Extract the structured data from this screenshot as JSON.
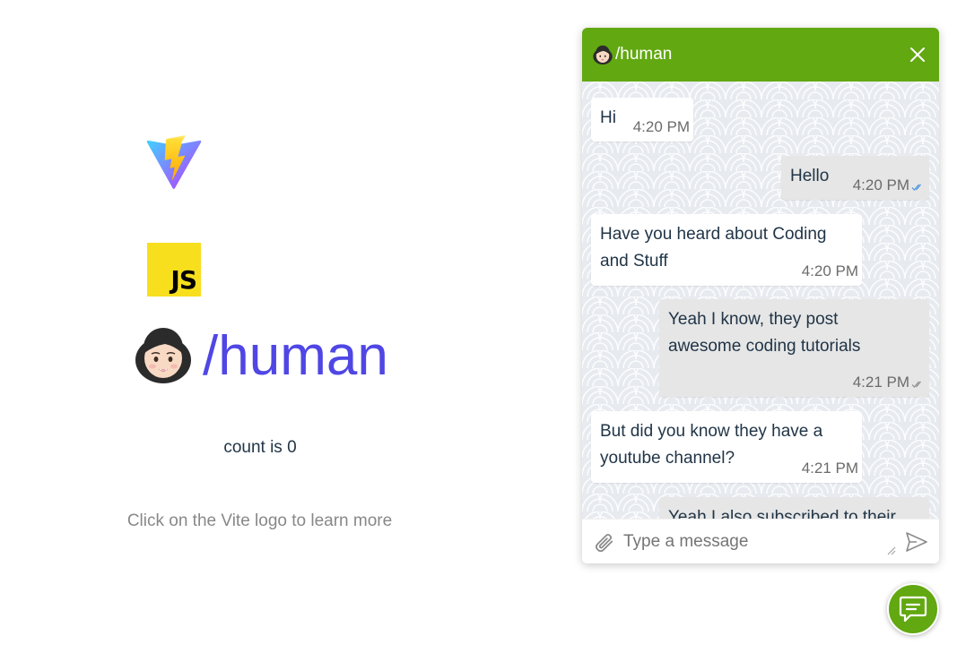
{
  "app": {
    "title": "/human",
    "count_label": "count is 0",
    "hint": "Click on the Vite logo to learn more",
    "js_logo_text": "JS"
  },
  "chat": {
    "header_title": "/human",
    "composer_placeholder": "Type a message",
    "messages": [
      {
        "direction": "in",
        "text": "Hi",
        "time": "4:20 PM"
      },
      {
        "direction": "out",
        "text": "Hello",
        "time": "4:20 PM",
        "status": "read"
      },
      {
        "direction": "in",
        "text_lines": [
          "Have you heard about Coding",
          "and Stuff"
        ],
        "time": "4:20 PM"
      },
      {
        "direction": "out",
        "text_lines": [
          "Yeah I know, they post",
          "awesome coding tutorials"
        ],
        "time": "4:21 PM",
        "status": "delivered"
      },
      {
        "direction": "in",
        "text_lines": [
          "But did you know they have a",
          "youtube channel?"
        ],
        "time": "4:21 PM"
      },
      {
        "direction": "out",
        "text": "Yeah I also subscribed to their"
      }
    ]
  },
  "colors": {
    "header": "#62a811",
    "accent_title": "#4f46e5",
    "read_check": "#4a90e2",
    "incoming_bubble": "#ffffff",
    "outgoing_bubble": "#e6e6e6"
  },
  "icons": {
    "vite": "vite-logo-icon",
    "js": "javascript-logo-icon",
    "avatar": "woman-face-icon",
    "close": "close-icon",
    "attach": "paperclip-icon",
    "send": "send-icon",
    "launcher": "chat-bubble-icon"
  }
}
